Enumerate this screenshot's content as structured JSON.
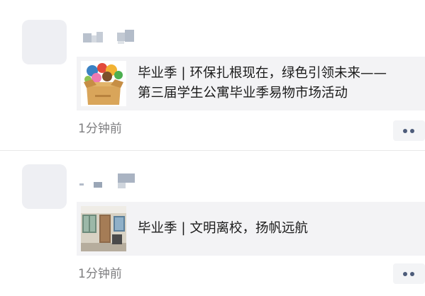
{
  "posts": [
    {
      "title_line1": "毕业季 | 环保扎根现在，绿色引领未来——",
      "title_line2": "第三届学生公寓毕业季易物市场活动",
      "thumbnail_icon": "box-of-toys-image",
      "time": "1分钟前",
      "more_icon": "more-dots-icon"
    },
    {
      "title_line1": "毕业季 | 文明离校，扬帆远航",
      "thumbnail_icon": "classroom-photo-image",
      "time": "1分钟前",
      "more_icon": "more-dots-icon"
    }
  ],
  "colors": {
    "background": "#ffffff",
    "card_background": "#f3f3f5",
    "avatar_placeholder": "#eeeff3",
    "time_text": "#7e7e80",
    "title_text": "#1b1b1b",
    "more_dots": "#4d5c7a"
  }
}
